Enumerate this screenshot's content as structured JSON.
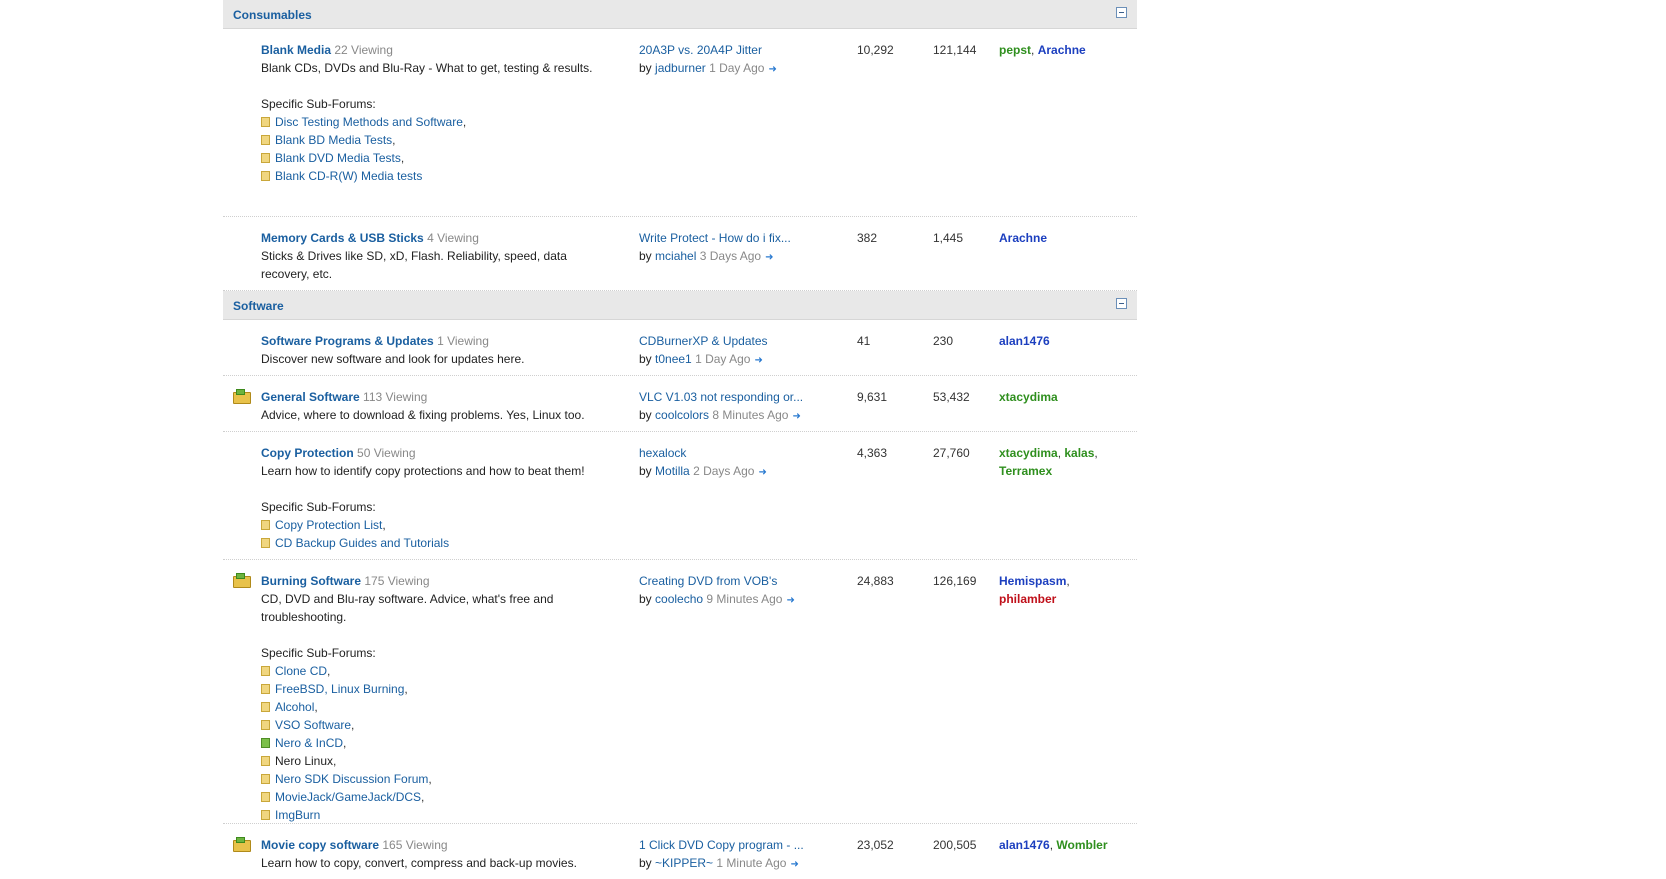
{
  "categories": [
    {
      "title": "Consumables",
      "forums": [
        {
          "name": "Blank Media",
          "viewing": "22 Viewing",
          "desc": "Blank CDs, DVDs and Blu-Ray - What to get, testing & results.",
          "subhead": "Specific Sub-Forums:",
          "subs": [
            "Disc Testing Methods and Software",
            "Blank BD Media Tests",
            "Blank DVD Media Tests",
            "Blank CD-R(W) Media tests"
          ],
          "last": {
            "title": "20A3P vs. 20A4P Jitter",
            "by": "by",
            "user": "jadburner",
            "time": "1 Day Ago"
          },
          "threads": "10,292",
          "posts": "121,144",
          "mods": [
            "pepst",
            "Arachne"
          ]
        },
        {
          "name": "Memory Cards & USB Sticks",
          "viewing": "4 Viewing",
          "desc": "Sticks & Drives like SD, xD, Flash. Reliability, speed, data recovery, etc.",
          "last": {
            "title": "Write Protect - How do i fix...",
            "by": "by",
            "user": "mciahel",
            "time": "3 Days Ago"
          },
          "threads": "382",
          "posts": "1,445",
          "mods": [
            "Arachne"
          ]
        }
      ]
    },
    {
      "title": "Software",
      "forums": [
        {
          "name": "Software Programs & Updates",
          "viewing": "1 Viewing",
          "desc": "Discover new software and look for updates here.",
          "last": {
            "title": "CDBurnerXP & Updates",
            "by": "by",
            "user": "t0nee1",
            "time": "1 Day Ago"
          },
          "threads": "41",
          "posts": "230",
          "mods": [
            "alan1476"
          ]
        },
        {
          "name": "General Software",
          "viewing": "113 Viewing",
          "desc": "Advice, where to download & fixing problems. Yes, Linux too.",
          "last": {
            "title": "VLC V1.03 not responding or...",
            "by": "by",
            "user": "coolcolors",
            "time": "8 Minutes Ago"
          },
          "threads": "9,631",
          "posts": "53,432",
          "mods": [
            "xtacydima"
          ]
        },
        {
          "name": "Copy Protection",
          "viewing": "50 Viewing",
          "desc": "Learn how to identify copy protections and how to beat them!",
          "subhead": "Specific Sub-Forums:",
          "subs": [
            "Copy Protection List",
            "CD Backup Guides and Tutorials"
          ],
          "last": {
            "title": "hexalock",
            "by": "by",
            "user": "Motilla",
            "time": "2 Days Ago"
          },
          "threads": "4,363",
          "posts": "27,760",
          "mods": [
            "xtacydima",
            "kalas",
            "Terramex"
          ]
        },
        {
          "name": "Burning Software",
          "viewing": "175 Viewing",
          "desc": "CD, DVD and Blu-ray software. Advice, what's free and troubleshooting.",
          "subhead": "Specific Sub-Forums:",
          "subs": [
            "Clone CD",
            "FreeBSD, Linux Burning",
            "Alcohol",
            "VSO Software",
            "Nero & InCD",
            "Nero Linux",
            "Nero SDK Discussion Forum",
            "MovieJack/GameJack/DCS",
            "ImgBurn"
          ],
          "last": {
            "title": "Creating DVD from VOB's",
            "by": "by",
            "user": "coolecho",
            "time": "9 Minutes Ago"
          },
          "threads": "24,883",
          "posts": "126,169",
          "mods": [
            "Hemispasm",
            "philamber"
          ]
        },
        {
          "name": "Movie copy software",
          "viewing": "165 Viewing",
          "desc": "Learn how to copy, convert, compress and back-up movies.",
          "last": {
            "title": "1 Click DVD Copy program - ...",
            "by": "by",
            "user": "~KIPPER~",
            "time": "1 Minute Ago"
          },
          "threads": "23,052",
          "posts": "200,505",
          "mods": [
            "alan1476",
            "Wombler"
          ]
        }
      ]
    }
  ],
  "colors": {
    "link": "#1a5fa0",
    "mod_green": "#2f8f1e",
    "mod_blue": "#1c3fbf",
    "mod_red": "#c0101a",
    "category_bg": "#e8e8e8"
  },
  "icons": {
    "collapse": "collapse-icon",
    "forum_new": "forum-new-posts-icon",
    "sub_forum": "sub-forum-icon",
    "goto_last": "goto-last-post-icon"
  }
}
